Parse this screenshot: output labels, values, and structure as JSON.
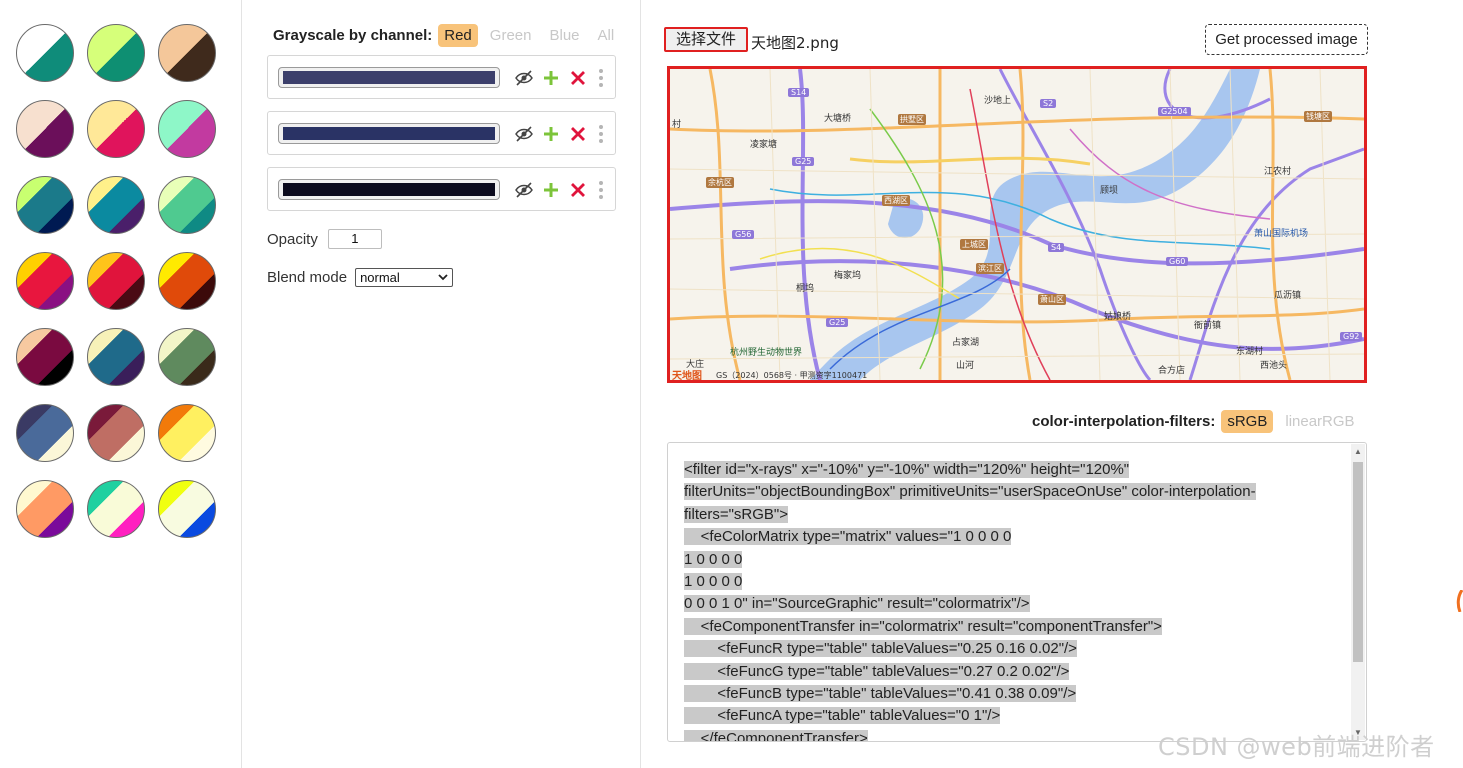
{
  "palette": {
    "swatches": [
      {
        "id": "1-1",
        "c1": "#0f8c7a",
        "c2": "#ffffff"
      },
      {
        "id": "1-2",
        "c1": "#0e8f72",
        "c2": "#d6ff7a"
      },
      {
        "id": "1-3",
        "c1": "#3f2a1c",
        "c2": "#f4c79a"
      },
      {
        "id": "2-1",
        "c1": "#6b0f5a",
        "c2": "#f7e0cf"
      },
      {
        "id": "2-2",
        "c1": "#e0145c",
        "c2": "#ffe898"
      },
      {
        "id": "2-3",
        "c1": "#c23aa0",
        "c2": "#8ef7c8"
      },
      {
        "id": "3-1",
        "c1": "#001a52",
        "c2": "#1b7a8a",
        "c3": "#c8ff70"
      },
      {
        "id": "3-2",
        "c1": "#4a1f6a",
        "c2": "#0b8aa0",
        "c3": "#fff08a"
      },
      {
        "id": "3-3",
        "c1": "#0f8a84",
        "c2": "#4fca90",
        "c3": "#e8ffb8"
      },
      {
        "id": "4-1",
        "c1": "#8a1082",
        "c2": "#e8163e",
        "c3": "#ffd000"
      },
      {
        "id": "4-2",
        "c1": "#4a0a14",
        "c2": "#e0143c",
        "c3": "#ffc41a"
      },
      {
        "id": "4-3",
        "c1": "#3c0a0a",
        "c2": "#e04a0a",
        "c3": "#ffea00"
      },
      {
        "id": "5-1",
        "c1": "#000000",
        "c2": "#7a0a40",
        "c3": "#f7c9a0"
      },
      {
        "id": "5-2",
        "c1": "#3a1e5a",
        "c2": "#1f6a8a",
        "c3": "#f7f1b8"
      },
      {
        "id": "5-3",
        "c1": "#3a2a1a",
        "c2": "#5f8a5e",
        "c3": "#f2f5c8"
      },
      {
        "id": "6-1",
        "c1": "#fbf7d8",
        "c2": "#4a6a9a",
        "c3": "#3a3a64"
      },
      {
        "id": "6-2",
        "c1": "#fbf7d8",
        "c2": "#bf6e64",
        "c3": "#7a1a3a"
      },
      {
        "id": "6-3",
        "c1": "#fffbe0",
        "c2": "#fff060",
        "c3": "#f27a0a"
      },
      {
        "id": "7-1",
        "c1": "#7a0a9a",
        "c2": "#ff9a64",
        "c3": "#fff8d0"
      },
      {
        "id": "7-2",
        "c1": "#ff20c0",
        "c2": "#f9fbd8",
        "c3": "#20d0a0"
      },
      {
        "id": "7-3",
        "c1": "#0a4ae0",
        "c2": "#f8fbe0",
        "c3": "#f0ff10"
      }
    ]
  },
  "controls": {
    "channel_title": "Grayscale by channel:",
    "channels": [
      "Red",
      "Green",
      "Blue",
      "All"
    ],
    "active_channel": "Red",
    "color_rows": [
      {
        "color": "#3c3f6b"
      },
      {
        "color": "#2a3365"
      },
      {
        "color": "#0b0a1d"
      }
    ],
    "opacity_label": "Opacity",
    "opacity_value": "1",
    "blend_label": "Blend mode",
    "blend_value": "normal",
    "accent_color": "#f8c37a"
  },
  "right": {
    "file_button": "选择文件",
    "file_name": "天地图2.png",
    "get_button": "Get processed image",
    "map": {
      "labels": {
        "s14": "S14",
        "shasha": "沙地上",
        "s2": "S2",
        "g2504": "G2504",
        "qiantang": "钱塘区",
        "cun": "村",
        "dagang": "大塘桥",
        "gongshu": "拱墅区",
        "lingjia": "凌家塘",
        "g25a": "G25",
        "yuhang": "余杭区",
        "xihu": "西湖区",
        "guyu": "顾坝",
        "jiangcun": "江农村",
        "xiaoshan_airport": "萧山国际机场",
        "g56": "G56",
        "shangcheng": "上城区",
        "s4": "S4",
        "g60": "G60",
        "binjiang": "滨江区",
        "tongwu": "桐坞",
        "meijia": "梅家坞",
        "xiaoshan": "萧山区",
        "guali": "瓜沥镇",
        "g25b": "G25",
        "guniang": "姑娘桥",
        "yaqian": "衙前镇",
        "zhanjiahu": "占家湖",
        "zoo": "杭州野生动物世界",
        "dongxi": "东湖村",
        "xichi": "西池头",
        "dazhuang": "大庄",
        "shanhe": "山河",
        "hefang": "合方店",
        "g92": "G92",
        "tianditu": "天地图",
        "gs_number": "GS（2024）0568号 · 甲测资字1100471"
      }
    },
    "interp_title": "color-interpolation-filters:",
    "interp_options": [
      "sRGB",
      "linearRGB"
    ],
    "interp_active": "sRGB",
    "code_lines": [
      "<filter id=\"x-rays\" x=\"-10%\" y=\"-10%\" width=\"120%\" height=\"120%\"",
      "filterUnits=\"objectBoundingBox\" primitiveUnits=\"userSpaceOnUse\" color-interpolation-",
      "filters=\"sRGB\">",
      "    <feColorMatrix type=\"matrix\" values=\"1 0 0 0 0",
      "1 0 0 0 0",
      "1 0 0 0 0",
      "0 0 0 1 0\" in=\"SourceGraphic\" result=\"colormatrix\"/>",
      "    <feComponentTransfer in=\"colormatrix\" result=\"componentTransfer\">",
      "        <feFuncR type=\"table\" tableValues=\"0.25 0.16 0.02\"/>",
      "        <feFuncG type=\"table\" tableValues=\"0.27 0.2 0.02\"/>",
      "        <feFuncB type=\"table\" tableValues=\"0.41 0.38 0.09\"/>",
      "        <feFuncA type=\"table\" tableValues=\"0 1\"/>",
      "    </feComponentTransfer>"
    ]
  },
  "watermark": "CSDN @web前端进阶者"
}
